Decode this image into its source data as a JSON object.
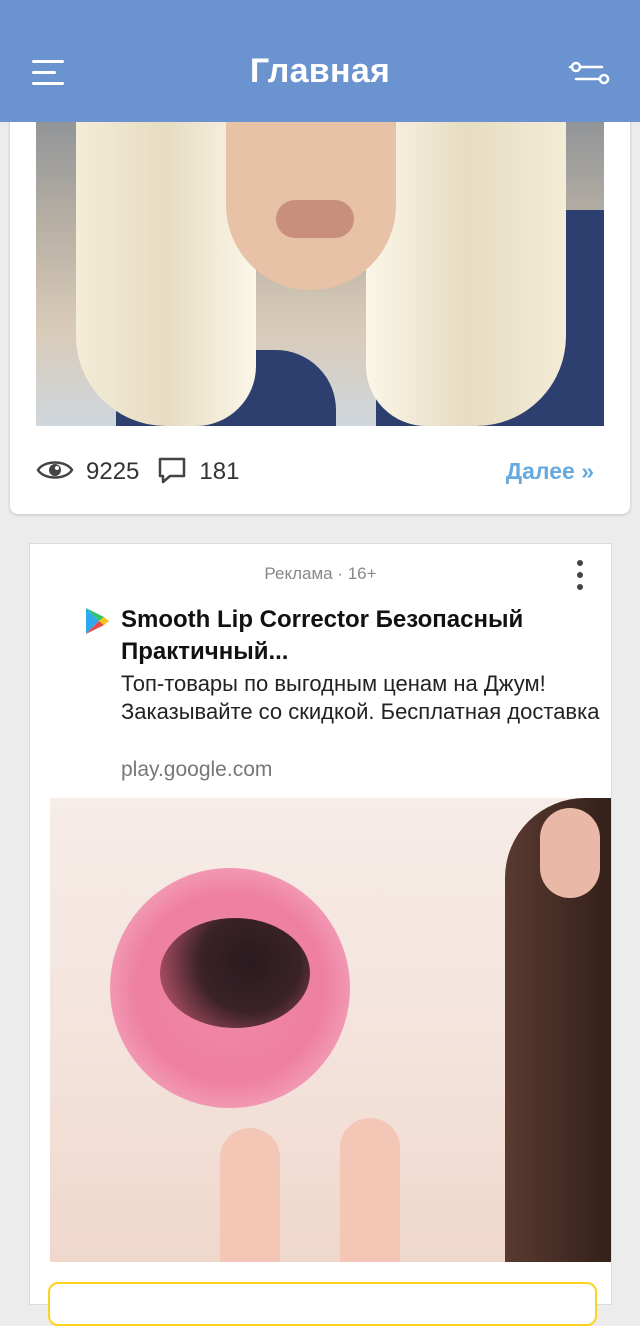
{
  "header": {
    "title": "Главная",
    "background": "#6a93cf"
  },
  "post": {
    "views": "9225",
    "comments": "181",
    "more_label": "Далее »"
  },
  "ad": {
    "label": "Реклама · 16+",
    "title": "Smooth Lip Corrector Безопасный Практичный...",
    "description": "Топ-товары по выгодным ценам на Джум! Заказывайте со скидкой. Бесплатная доставка",
    "domain": "play.google.com"
  },
  "icons": [
    "menu-icon",
    "filter-icon",
    "eye-icon",
    "comment-icon",
    "more-vertical-icon",
    "google-play-icon"
  ],
  "colors": {
    "accent_link": "#66a9df",
    "ad_button_border": "#ffd21f"
  }
}
